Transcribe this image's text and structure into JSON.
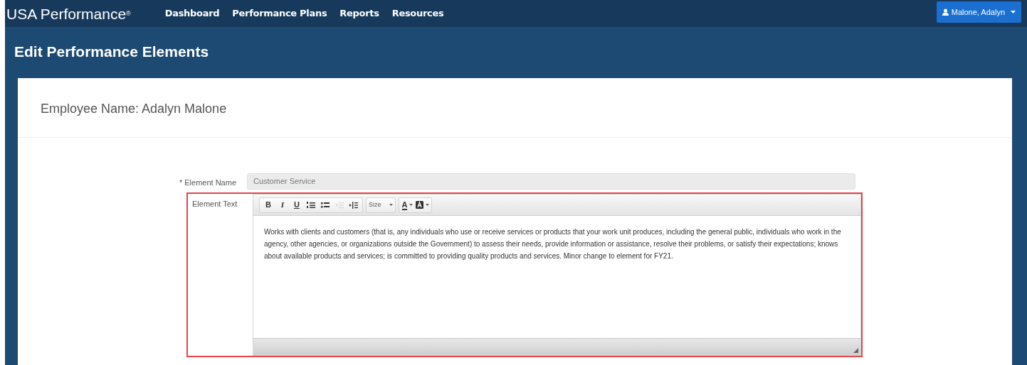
{
  "navbar": {
    "brand": "USA Performance",
    "brand_mark": "®",
    "links": [
      {
        "label": "Dashboard"
      },
      {
        "label": "Performance Plans"
      },
      {
        "label": "Reports"
      },
      {
        "label": "Resources"
      }
    ],
    "user_menu": {
      "label": "Malone, Adalyn"
    }
  },
  "page_title": "Edit Performance Elements",
  "employee_heading": "Employee Name: Adalyn Malone",
  "form": {
    "element_name": {
      "required_mark": "*",
      "label": "Element Name",
      "value": "Customer Service"
    },
    "element_text": {
      "label": "Element Text",
      "highlighted": true,
      "toolbar": [
        {
          "kind": "bold",
          "text": "B",
          "disabled": false
        },
        {
          "kind": "italic",
          "text": "I",
          "disabled": false
        },
        {
          "kind": "underline",
          "text": "U",
          "disabled": false
        },
        {
          "kind": "ordered-list",
          "disabled": false
        },
        {
          "kind": "bullet-list",
          "disabled": false
        },
        {
          "kind": "outdent",
          "disabled": true
        },
        {
          "kind": "indent",
          "disabled": false
        },
        {
          "kind": "size",
          "text": "Size",
          "disabled": false
        },
        {
          "kind": "text-color",
          "text": "A",
          "disabled": false
        },
        {
          "kind": "background-color",
          "disabled": false
        }
      ],
      "content": "Works with clients and customers (that is, any individuals who use or receive services or products that your work unit produces, including the general public, individuals who work in the agency, other agencies, or organizations outside the Government) to assess their needs, provide information or assistance, resolve their problems, or satisfy their expectations; knows about available products and services; is committed to providing quality products and services. Minor change to element for FY21."
    }
  }
}
